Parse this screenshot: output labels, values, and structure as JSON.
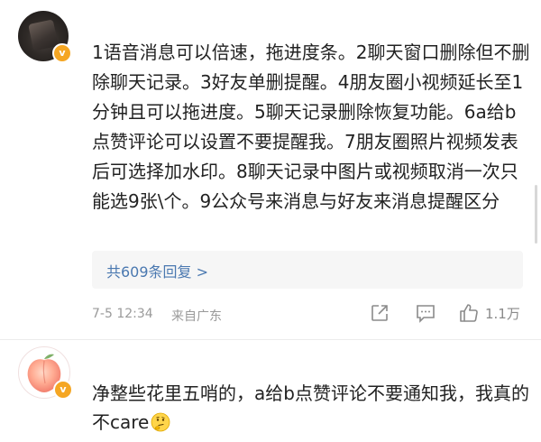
{
  "comments": [
    {
      "text": "1语音消息可以倍速，拖进度条。2聊天窗口删除但不删除聊天记录。3好友单删提醒。4朋友圈小视频延长至1分钟且可以拖进度。5聊天记录删除恢复功能。6a给b点赞评论可以设置不要提醒我。7朋友圈照片视频发表后可选择加水印。8聊天记录中图片或视频取消一次只能选9张\\个。9公众号来消息与好友来消息提醒区分",
      "replies_label": "共609条回复 >",
      "time": "7-5 12:34",
      "location": "来自广东",
      "likes": "1.1万",
      "avatar_badge": "v"
    },
    {
      "text": "净整些花里五哨的，a给b点赞评论不要通知我，我真的不care",
      "avatar_badge": "v"
    }
  ],
  "colors": {
    "accent_link": "#4a78b0",
    "badge": "#f5a623",
    "meta": "#9a9a9a"
  },
  "icons": [
    "share-icon",
    "comment-icon",
    "like-icon",
    "thinking-emoji-icon",
    "verified-badge-icon"
  ]
}
